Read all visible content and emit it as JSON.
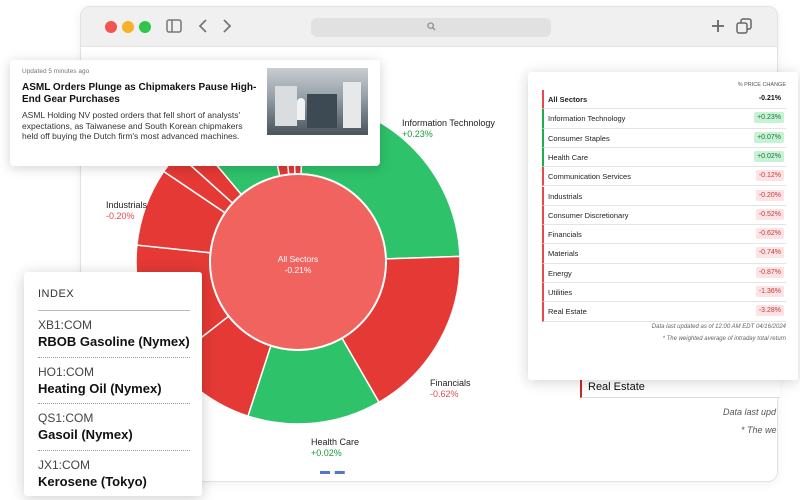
{
  "browser": {
    "icons": [
      "sidebar-icon",
      "back-icon",
      "forward-icon",
      "search-icon",
      "new-tab-icon",
      "tabs-icon"
    ]
  },
  "news": {
    "updated": "Updated 5 minutes ago",
    "headline": "ASML Orders Plunge as Chipmakers Pause High-End Gear Purchases",
    "body": "ASML Holding NV posted orders that fell short of analysts' expectations, as Taiwanese and South Korean chipmakers held off buying the Dutch firm's most advanced machines."
  },
  "donut": {
    "center_name": "All Sectors",
    "center_value": "-0.21%",
    "labels": [
      {
        "name": "Information Technology",
        "value": "+0.23%",
        "dir": "pos"
      },
      {
        "name": "Industrials",
        "value": "-0.20%",
        "dir": "neg"
      },
      {
        "name": "Financials",
        "value": "-0.62%",
        "dir": "neg"
      },
      {
        "name": "Health Care",
        "value": "+0.02%",
        "dir": "pos"
      }
    ],
    "colors": {
      "positive": "#2ec26a",
      "negative": "#e53935",
      "center": "#f0635f"
    }
  },
  "sectors": {
    "header": "% PRICE CHANGE",
    "rows": [
      {
        "name": "All Sectors",
        "change": "-0.21%",
        "dir": "all"
      },
      {
        "name": "Information Technology",
        "change": "+0.23%",
        "dir": "up"
      },
      {
        "name": "Consumer Staples",
        "change": "+0.07%",
        "dir": "up"
      },
      {
        "name": "Health Care",
        "change": "+0.02%",
        "dir": "up"
      },
      {
        "name": "Communication Services",
        "change": "-0.12%",
        "dir": "dn"
      },
      {
        "name": "Industrials",
        "change": "-0.20%",
        "dir": "dn"
      },
      {
        "name": "Consumer Discretionary",
        "change": "-0.52%",
        "dir": "dn"
      },
      {
        "name": "Financials",
        "change": "-0.62%",
        "dir": "dn"
      },
      {
        "name": "Materials",
        "change": "-0.74%",
        "dir": "dn"
      },
      {
        "name": "Energy",
        "change": "-0.87%",
        "dir": "dn"
      },
      {
        "name": "Utilities",
        "change": "-1.36%",
        "dir": "dn"
      },
      {
        "name": "Real Estate",
        "change": "-3.28%",
        "dir": "dn"
      }
    ],
    "footnote1": "Data last updated as of 12:00 AM EDT 04/16/2024",
    "footnote2": "* The weighted average of intraday total return"
  },
  "background": {
    "real_estate": "Real Estate",
    "data_last": "Data last upd",
    "weighted": "* The we"
  },
  "index": {
    "title": "INDEX",
    "items": [
      {
        "code": "XB1:COM",
        "name": "RBOB Gasoline (Nymex)"
      },
      {
        "code": "HO1:COM",
        "name": "Heating Oil (Nymex)"
      },
      {
        "code": "QS1:COM",
        "name": "Gasoil (Nymex)"
      },
      {
        "code": "JX1:COM",
        "name": "Kerosene (Tokyo)"
      }
    ]
  }
}
